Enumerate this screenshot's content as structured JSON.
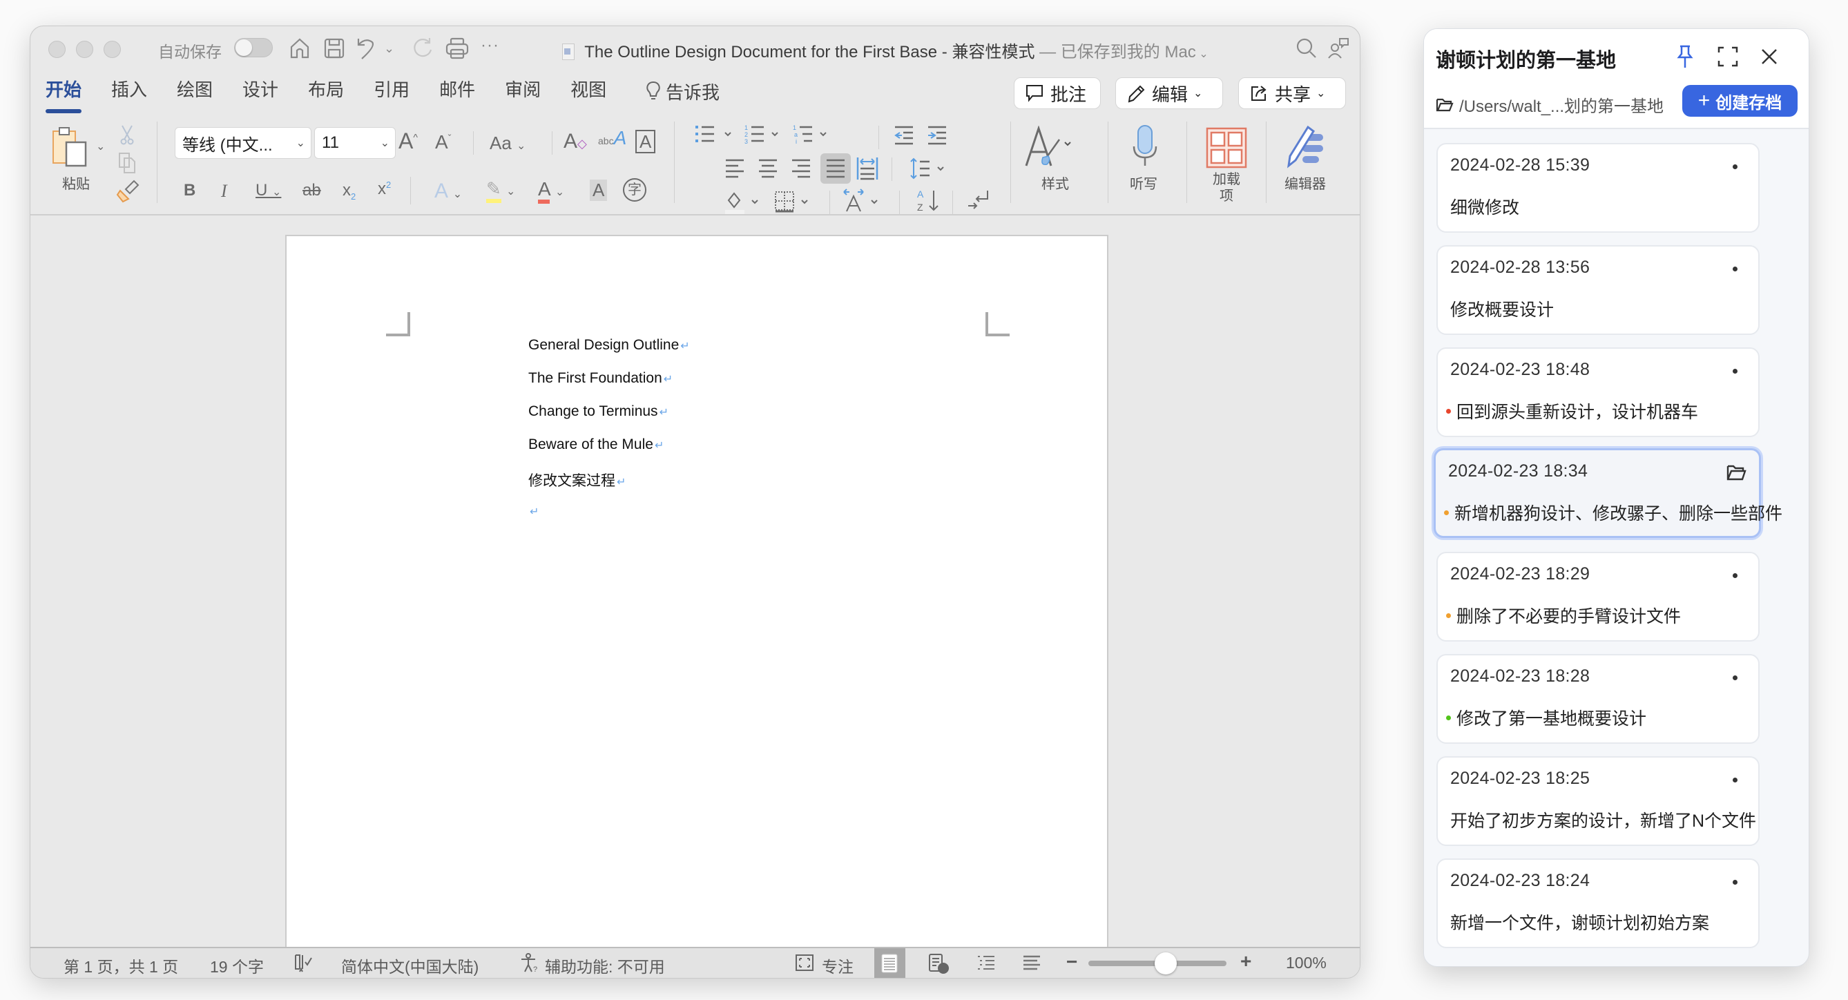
{
  "word": {
    "autosave_label": "自动保存",
    "autosave_on": false,
    "doc_title": "The Outline Design Document for the First Base",
    "title_sep": " - ",
    "compat_mode": "兼容性模式",
    "save_status": " — 已保存到我的 Mac",
    "tabs": [
      {
        "label": "开始",
        "active": true
      },
      {
        "label": "插入"
      },
      {
        "label": "绘图"
      },
      {
        "label": "设计"
      },
      {
        "label": "布局"
      },
      {
        "label": "引用"
      },
      {
        "label": "邮件"
      },
      {
        "label": "审阅"
      },
      {
        "label": "视图"
      }
    ],
    "tell_me": "告诉我",
    "comment_btn": "批注",
    "edit_btn": "编辑",
    "share_btn": "共享",
    "ribbon": {
      "paste_label": "粘贴",
      "font_name": "等线 (中文...",
      "font_size": "11",
      "styles_label": "样式",
      "dictate_label": "听写",
      "addins_label": "加载项",
      "editor_label": "编辑器"
    },
    "document": {
      "paragraphs": [
        "General Design Outline",
        "The First Foundation",
        "Change to Terminus",
        "Beware of the Mule",
        "修改文案过程",
        ""
      ],
      "paragraph_mark": "↵"
    },
    "statusbar": {
      "page": "第 1 页，共 1 页",
      "words": "19 个字",
      "language": "简体中文(中国大陆)",
      "accessibility": "辅助功能: 不可用",
      "focus": "专注",
      "zoom_percent": "100%",
      "zoom_value": 100
    }
  },
  "panel": {
    "title": "谢顿计划的第一基地",
    "path": "/Users/walt_...划的第一基地",
    "create_btn": "创建存档",
    "accent": "#3866e0",
    "snapshots": [
      {
        "time": "2024-02-28 15:39",
        "desc": "细微修改",
        "dot": null
      },
      {
        "time": "2024-02-28 13:56",
        "desc": "修改概要设计",
        "dot": null
      },
      {
        "time": "2024-02-23 18:48",
        "desc": "回到源头重新设计，设计机器车",
        "dot": "#e8452c"
      },
      {
        "time": "2024-02-23 18:34",
        "desc": "新增机器狗设计、修改骡子、删除一些部件",
        "dot": "#f0a030",
        "selected": true
      },
      {
        "time": "2024-02-23 18:29",
        "desc": "删除了不必要的手臂设计文件",
        "dot": "#f0a030"
      },
      {
        "time": "2024-02-23 18:28",
        "desc": "修改了第一基地概要设计",
        "dot": "#52c41a"
      },
      {
        "time": "2024-02-23 18:25",
        "desc": "开始了初步方案的设计，新增了N个文件",
        "dot": null
      },
      {
        "time": "2024-02-23 18:24",
        "desc": "新增一个文件，谢顿计划初始方案",
        "dot": null
      }
    ]
  }
}
